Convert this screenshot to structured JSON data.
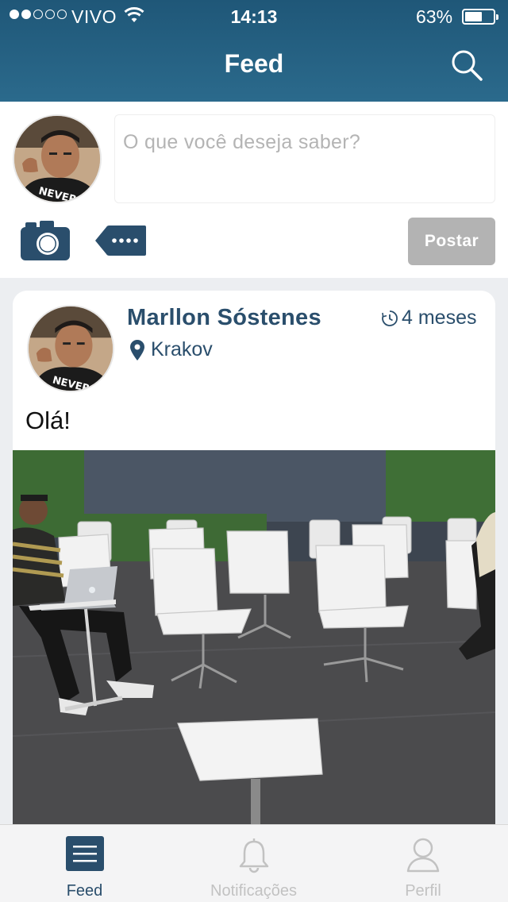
{
  "status_bar": {
    "carrier": "VIVO",
    "time": "14:13",
    "battery_percent": "63%",
    "battery_level": 0.63,
    "signal_bars_filled": 2,
    "signal_bars_total": 5
  },
  "nav": {
    "title": "Feed",
    "search_icon": "search-icon"
  },
  "composer": {
    "placeholder": "O que você deseja saber?",
    "camera_icon": "camera-icon",
    "tag_icon": "more-tag-icon",
    "post_label": "Postar"
  },
  "post": {
    "author": "Marllon Sóstenes",
    "time_ago": "4 meses",
    "location": "Krakov",
    "text": "Olá!"
  },
  "tabs": [
    {
      "label": "Feed",
      "icon": "menu-icon",
      "active": true
    },
    {
      "label": "Notificações",
      "icon": "bell-icon",
      "active": false
    },
    {
      "label": "Perfil",
      "icon": "user-icon",
      "active": false
    }
  ],
  "colors": {
    "header": "#245f80",
    "accent": "#2a4e6c",
    "post_button": "#b3b3b3",
    "inactive_tab": "#c2c2c2"
  }
}
